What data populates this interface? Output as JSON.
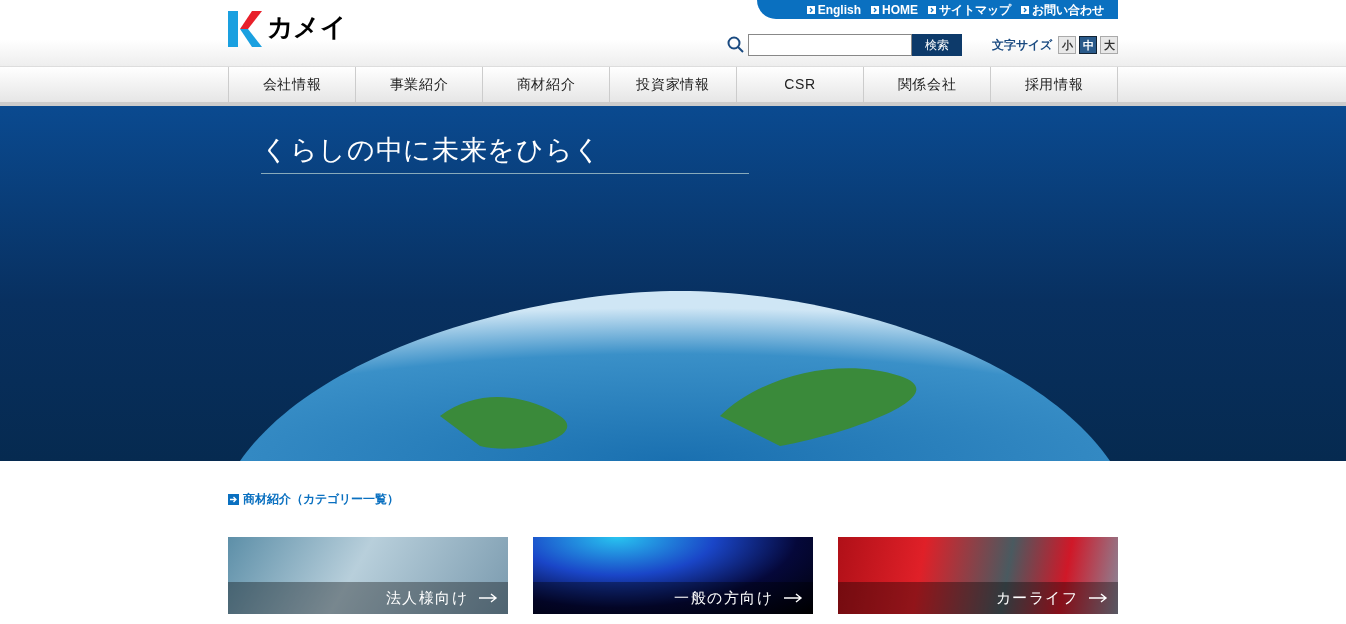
{
  "logo": {
    "text": "カメイ"
  },
  "top_links": [
    "English",
    "HOME",
    "サイトマップ",
    "お問い合わせ"
  ],
  "search": {
    "button": "検索"
  },
  "font_size": {
    "label": "文字サイズ",
    "options": [
      {
        "label": "小",
        "selected": false
      },
      {
        "label": "中",
        "selected": true
      },
      {
        "label": "大",
        "selected": false
      }
    ]
  },
  "nav": [
    "会社情報",
    "事業紹介",
    "商材紹介",
    "投資家情報",
    "CSR",
    "関係会社",
    "採用情報"
  ],
  "hero": {
    "tagline": "くらしの中に未来をひらく"
  },
  "section": {
    "heading": "商材紹介（カテゴリー一覧）"
  },
  "cards": [
    {
      "label": "法人様向け",
      "kind": "business"
    },
    {
      "label": "一般の方向け",
      "kind": "flame"
    },
    {
      "label": "カーライフ",
      "kind": "car"
    }
  ]
}
